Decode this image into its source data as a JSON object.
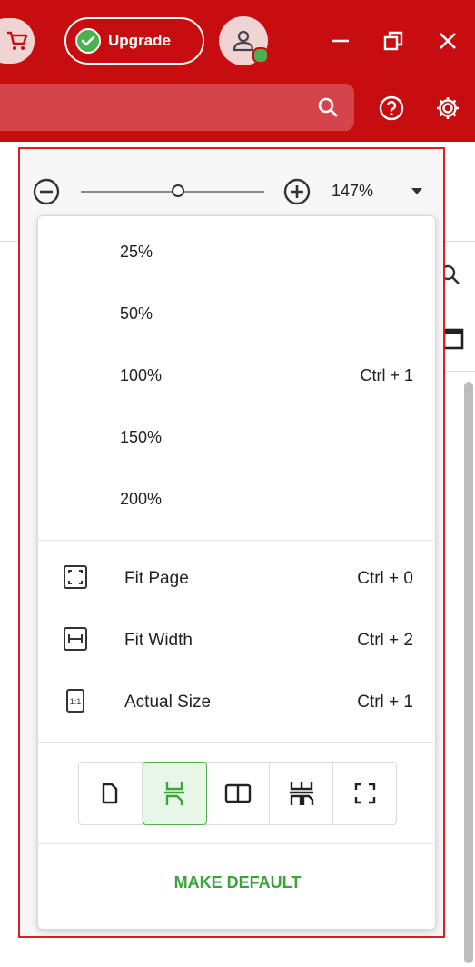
{
  "header": {
    "upgrade_label": "Upgrade",
    "brand_color": "#c80d10",
    "icons": [
      "cart-icon",
      "check-circle-icon",
      "user-icon",
      "minimize-icon",
      "restore-icon",
      "close-icon",
      "search-icon",
      "help-icon",
      "settings-icon"
    ]
  },
  "zoom": {
    "current": "147%",
    "slider_fraction": 0.53
  },
  "menu": {
    "presets": [
      {
        "label": "25%",
        "shortcut": ""
      },
      {
        "label": "50%",
        "shortcut": ""
      },
      {
        "label": "100%",
        "shortcut": "Ctrl + 1"
      },
      {
        "label": "150%",
        "shortcut": ""
      },
      {
        "label": "200%",
        "shortcut": ""
      }
    ],
    "fit_options": [
      {
        "label": "Fit Page",
        "shortcut": "Ctrl + 0",
        "icon": "fit-page-icon"
      },
      {
        "label": "Fit Width",
        "shortcut": "Ctrl + 2",
        "icon": "fit-width-icon"
      },
      {
        "label": "Actual Size",
        "shortcut": "Ctrl + 1",
        "icon": "actual-size-icon",
        "icon_text": "1:1"
      }
    ],
    "view_modes": [
      {
        "icon": "single-page-icon",
        "active": false
      },
      {
        "icon": "continuous-scroll-icon",
        "active": true
      },
      {
        "icon": "two-page-icon",
        "active": false
      },
      {
        "icon": "two-page-scroll-icon",
        "active": false
      },
      {
        "icon": "fullscreen-icon",
        "active": false
      }
    ],
    "make_default_label": "MAKE DEFAULT",
    "accent_color": "#3aa33a"
  }
}
